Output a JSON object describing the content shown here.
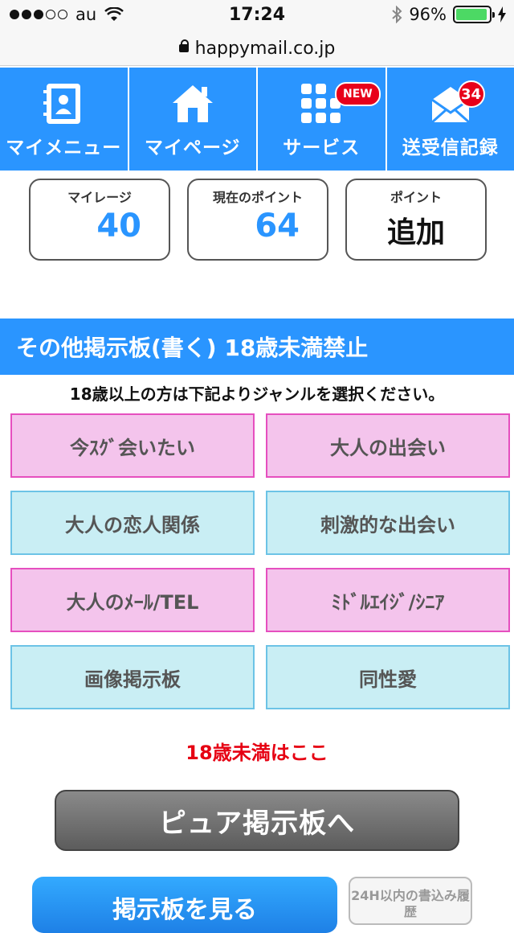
{
  "status_bar": {
    "carrier": "au",
    "time": "17:24",
    "battery": "96%",
    "battery_level": 0.96,
    "signal_bars_filled": 3,
    "signal_bars_total": 5
  },
  "url_bar": {
    "domain": "happymail.co.jp"
  },
  "nav": {
    "items": [
      {
        "label": "マイメニュー",
        "icon": "address-book-icon"
      },
      {
        "label": "マイページ",
        "icon": "home-icon"
      },
      {
        "label": "サービス",
        "icon": "grid-icon",
        "badge": "NEW"
      },
      {
        "label": "送受信記録",
        "icon": "mail-icon",
        "badge": "34"
      }
    ]
  },
  "points": {
    "mileage": {
      "label": "マイレージ",
      "value": "40"
    },
    "current_points": {
      "label": "現在のポイント",
      "value": "64"
    },
    "add_points": {
      "label": "ポイント",
      "action": "追加"
    }
  },
  "section": {
    "title": "その他掲示板(書く) 18歳未満禁止",
    "instruction": "18歳以上の方は下記よりジャンルを選択ください。"
  },
  "genres": [
    {
      "label": "今ｽｸﾞ会いたい",
      "color": "pink"
    },
    {
      "label": "大人の出会い",
      "color": "pink"
    },
    {
      "label": "大人の恋人関係",
      "color": "blue"
    },
    {
      "label": "刺激的な出会い",
      "color": "blue"
    },
    {
      "label": "大人のﾒｰﾙ/TEL",
      "color": "pink"
    },
    {
      "label": "ﾐﾄﾞﾙｴｲｼﾞ/ｼﾆｱ",
      "color": "pink"
    },
    {
      "label": "画像掲示板",
      "color": "blue"
    },
    {
      "label": "同性愛",
      "color": "blue"
    }
  ],
  "under18_link": "18歳未満はここ",
  "buttons": {
    "pure": "ピュア掲示板へ",
    "view": "掲示板を見る",
    "history": "24H以内の書込み履歴"
  },
  "colors": {
    "accent_blue": "#2a95ff",
    "pink_fill": "#f4c4ec",
    "blue_fill": "#c9eef4",
    "warning_red": "#e60012"
  }
}
